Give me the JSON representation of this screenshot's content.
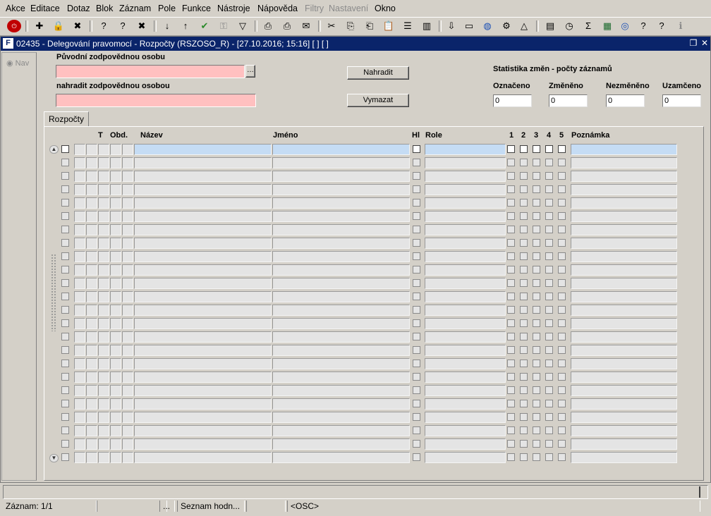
{
  "menu": [
    "Akce",
    "Editace",
    "Dotaz",
    "Blok",
    "Záznam",
    "Pole",
    "Funkce",
    "Nástroje",
    "Nápověda",
    "Filtry",
    "Nastavení",
    "Okno"
  ],
  "menu_disabled": [
    "Filtry",
    "Nastavení"
  ],
  "toolbar_icons": [
    "exit-icon",
    "insert-record-icon",
    "lock-record-icon",
    "delete-record-icon",
    "query-enter-icon",
    "query-execute-icon",
    "query-cancel-icon",
    "sort-asc-icon",
    "sort-desc-icon",
    "save-check-icon",
    "key-icon",
    "filter-icon",
    "print-icon",
    "print-setup-icon",
    "mail-icon",
    "cut-icon",
    "copy-icon",
    "paste-icon",
    "clipboard-icon",
    "list-icon",
    "columns-icon",
    "import-icon",
    "page-icon",
    "globe-icon",
    "settings-icon",
    "triangle-icon",
    "chart-icon",
    "clock-icon",
    "sum-icon",
    "excel-icon",
    "ie-icon",
    "help-icon",
    "context-help-icon",
    "info-icon"
  ],
  "window": {
    "title": "02435 - Delegování pravomocí - Rozpočty (RSZOSO_R) - [27.10.2016; 15:16]  [ ]  [ ]"
  },
  "nav": {
    "label": "Nav"
  },
  "form": {
    "orig_label": "Původní zodpovědnou osobu",
    "orig_value": "",
    "replace_label": "nahradit zodpovědnou osobou",
    "replace_value": "",
    "lov_button": "…",
    "btn_replace": "Nahradit",
    "btn_clear": "Vymazat"
  },
  "stats": {
    "title": "Statistika změn - počty záznamů",
    "labels": [
      "Označeno",
      "Změněno",
      "Nezměněno",
      "Uzamčeno"
    ],
    "values": [
      "0",
      "0",
      "0",
      "0"
    ]
  },
  "tab": {
    "label": "Rozpočty"
  },
  "grid": {
    "headers": {
      "t": "T",
      "obd": "Obd.",
      "nazev": "Název",
      "jmeno": "Jméno",
      "hl": "Hl",
      "role": "Role",
      "c1": "1",
      "c2": "2",
      "c3": "3",
      "c4": "4",
      "c5": "5",
      "poznamka": "Poznámka"
    },
    "row_count": 24
  },
  "status": {
    "record": "Záznam: 1/1",
    "ellipsis": "...",
    "list": "Seznam hodn...",
    "osc": "<OSC>"
  }
}
